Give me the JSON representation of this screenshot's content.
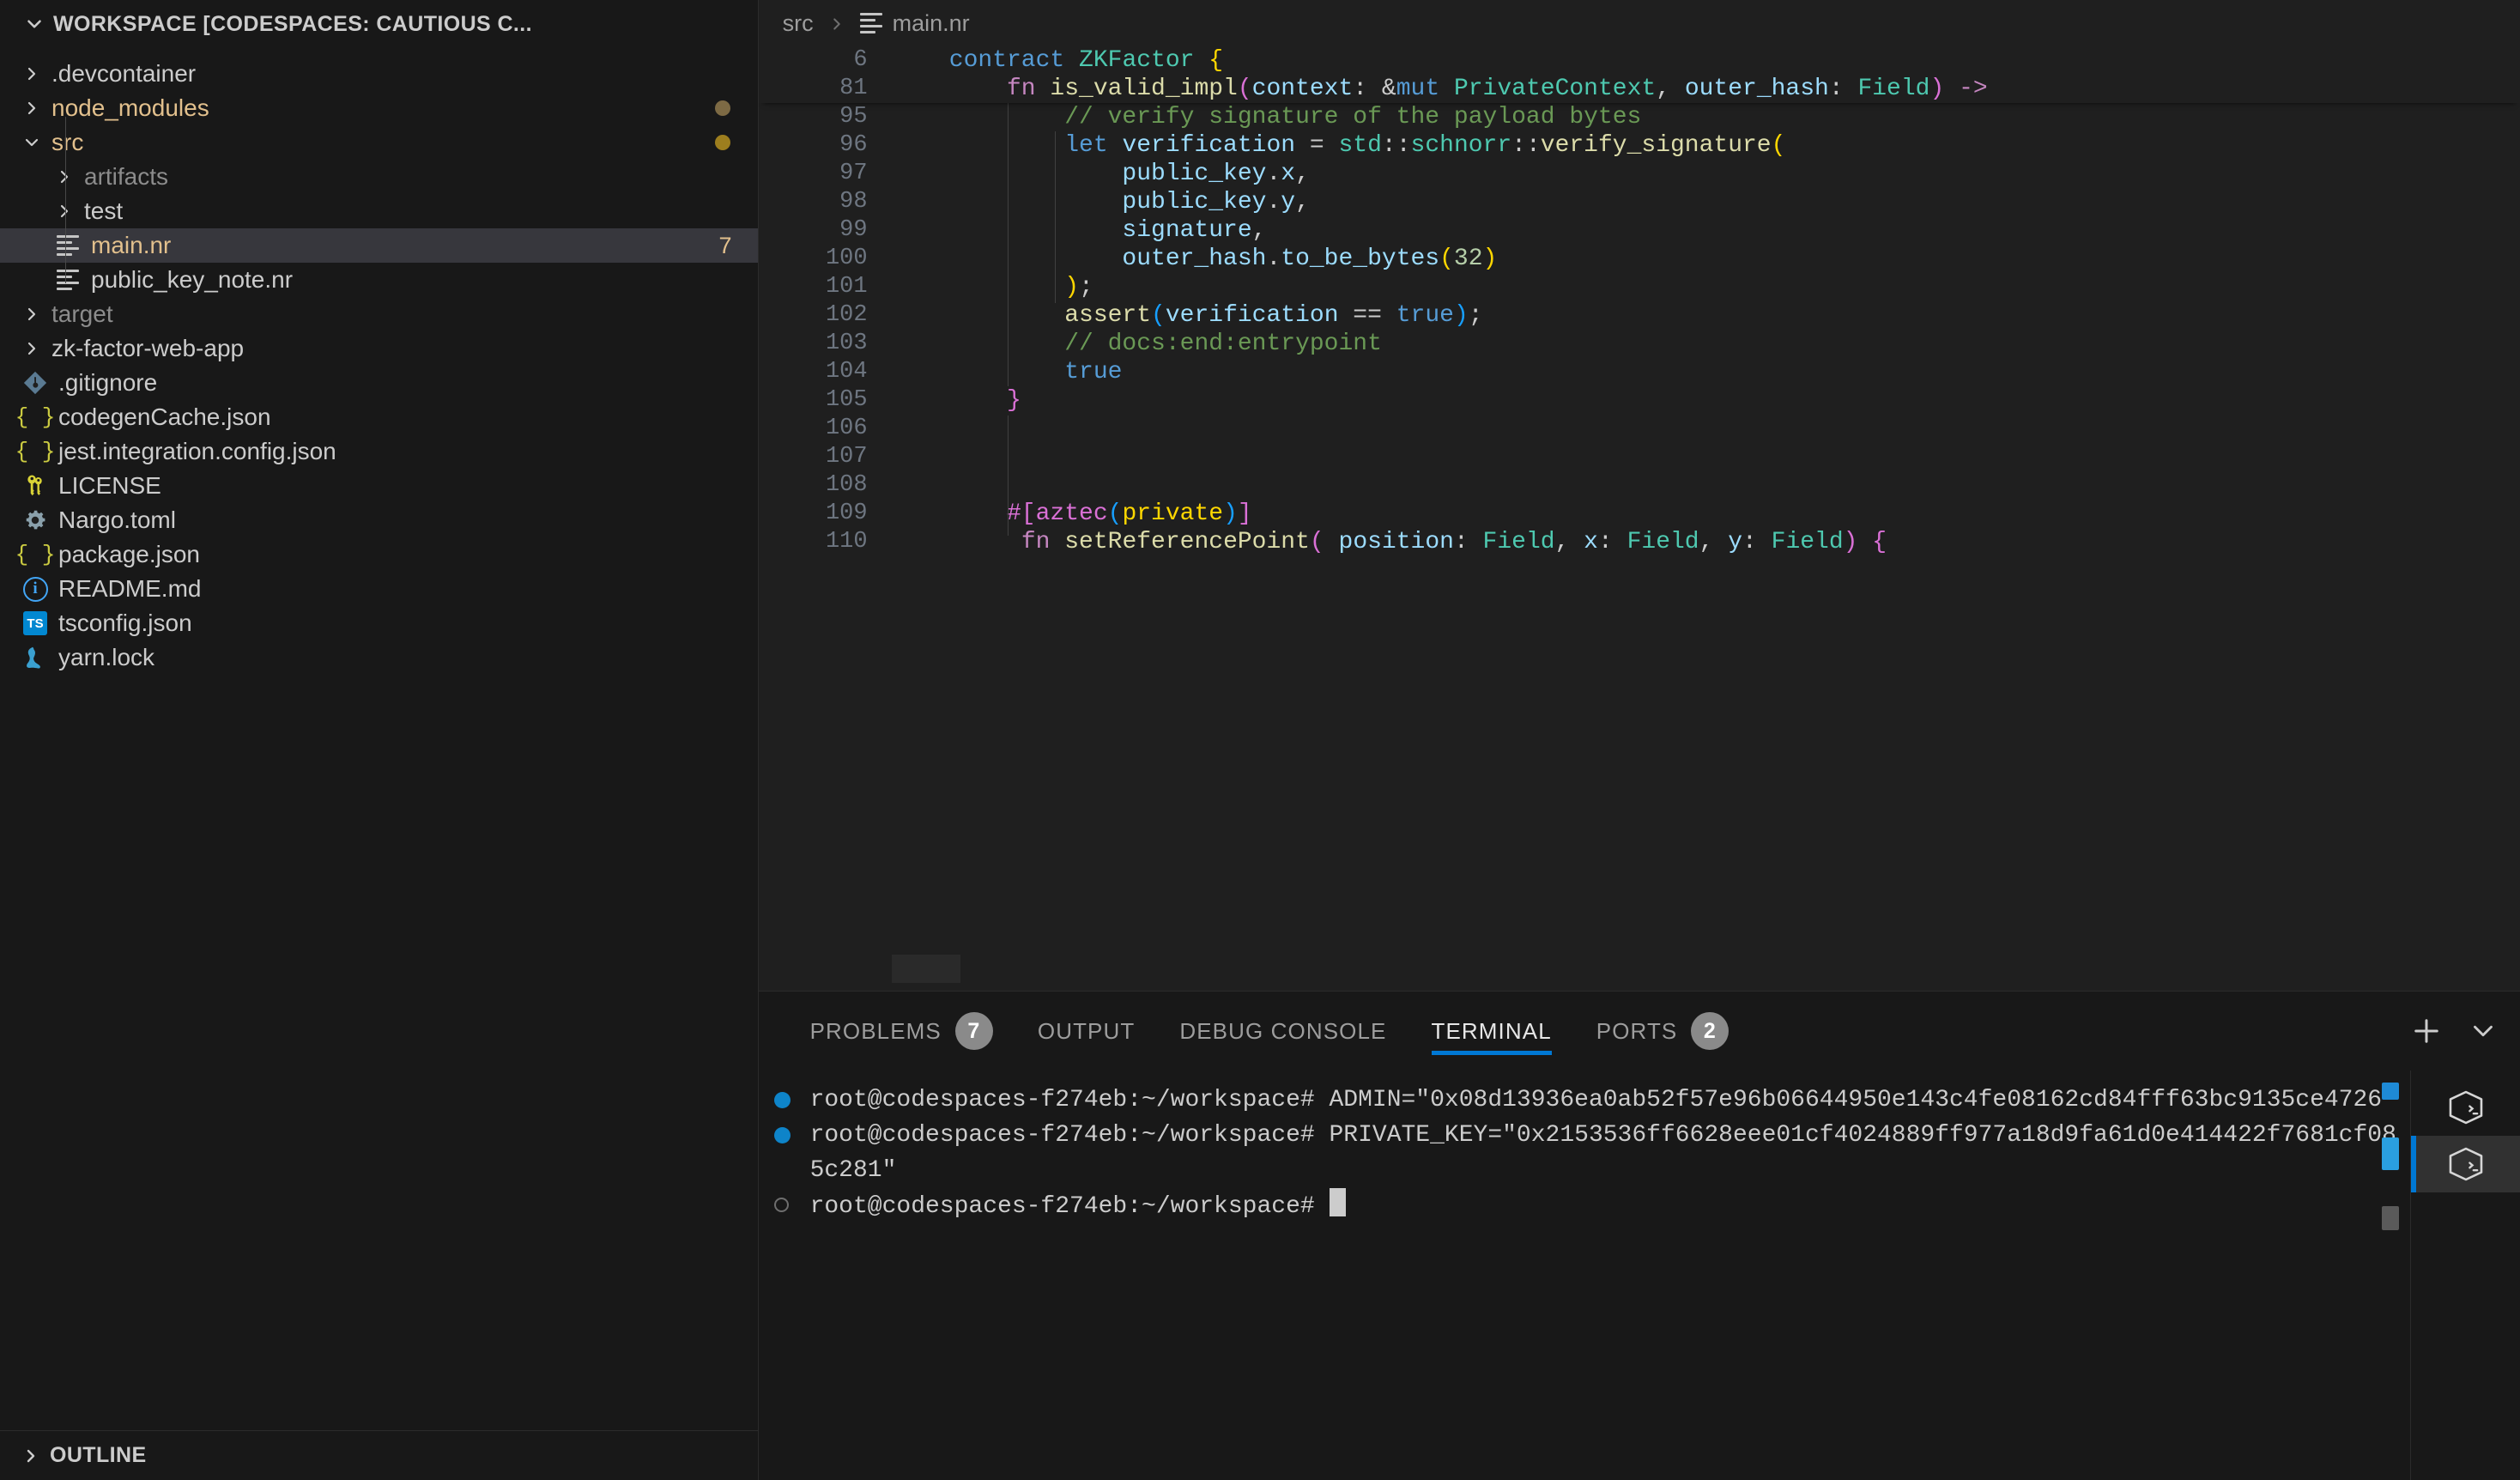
{
  "sidebar": {
    "workspace_title": "WORKSPACE [CODESPACES: CAUTIOUS C...",
    "outline_label": "OUTLINE",
    "items": [
      {
        "label": ".devcontainer",
        "kind": "folder",
        "depth": 1,
        "expanded": false,
        "color": "#cccccc",
        "icon": "chevron-right-icon",
        "badge": "",
        "dot": ""
      },
      {
        "label": "node_modules",
        "kind": "folder",
        "depth": 1,
        "expanded": false,
        "color": "#e2c08d",
        "icon": "chevron-right-icon",
        "badge": "",
        "dot": "#7d6a44"
      },
      {
        "label": "src",
        "kind": "folder",
        "depth": 1,
        "expanded": true,
        "color": "#e2c08d",
        "icon": "chevron-down-icon",
        "badge": "",
        "dot": "#9d7e1e"
      },
      {
        "label": "artifacts",
        "kind": "folder",
        "depth": 2,
        "expanded": false,
        "color": "#8c8c8c",
        "icon": "chevron-right-icon",
        "badge": "",
        "dot": ""
      },
      {
        "label": "test",
        "kind": "folder",
        "depth": 2,
        "expanded": false,
        "color": "#cccccc",
        "icon": "chevron-right-icon",
        "badge": "",
        "dot": ""
      },
      {
        "label": "main.nr",
        "kind": "file-lines",
        "depth": 2,
        "selected": true,
        "color": "#e2c08d",
        "icon": "file-lines-icon",
        "badge": "7",
        "dot": ""
      },
      {
        "label": "public_key_note.nr",
        "kind": "file-lines",
        "depth": 2,
        "color": "#cccccc",
        "icon": "file-lines-icon",
        "badge": "",
        "dot": ""
      },
      {
        "label": "target",
        "kind": "folder",
        "depth": 1,
        "expanded": false,
        "color": "#8c8c8c",
        "icon": "chevron-right-icon",
        "badge": "",
        "dot": ""
      },
      {
        "label": "zk-factor-web-app",
        "kind": "folder",
        "depth": 1,
        "expanded": false,
        "color": "#cccccc",
        "icon": "chevron-right-icon",
        "badge": "",
        "dot": ""
      },
      {
        "label": ".gitignore",
        "kind": "file-git",
        "depth": 1,
        "color": "#cccccc",
        "icon": "git-icon",
        "badge": "",
        "dot": ""
      },
      {
        "label": "codegenCache.json",
        "kind": "file-json",
        "depth": 1,
        "color": "#cccccc",
        "icon": "json-icon",
        "badge": "",
        "dot": ""
      },
      {
        "label": "jest.integration.config.json",
        "kind": "file-json",
        "depth": 1,
        "color": "#cccccc",
        "icon": "json-icon",
        "badge": "",
        "dot": ""
      },
      {
        "label": "LICENSE",
        "kind": "file-key",
        "depth": 1,
        "color": "#cccccc",
        "icon": "key-icon",
        "badge": "",
        "dot": ""
      },
      {
        "label": "Nargo.toml",
        "kind": "file-gear",
        "depth": 1,
        "color": "#cccccc",
        "icon": "gear-icon",
        "badge": "",
        "dot": ""
      },
      {
        "label": "package.json",
        "kind": "file-json",
        "depth": 1,
        "color": "#cccccc",
        "icon": "json-icon",
        "badge": "",
        "dot": ""
      },
      {
        "label": "README.md",
        "kind": "file-md",
        "depth": 1,
        "color": "#cccccc",
        "icon": "info-icon",
        "badge": "",
        "dot": ""
      },
      {
        "label": "tsconfig.json",
        "kind": "file-ts",
        "depth": 1,
        "color": "#cccccc",
        "icon": "typescript-icon",
        "badge": "",
        "dot": ""
      },
      {
        "label": "yarn.lock",
        "kind": "file-yarn",
        "depth": 1,
        "color": "#cccccc",
        "icon": "yarn-cat-icon",
        "badge": "",
        "dot": ""
      }
    ]
  },
  "breadcrumb": {
    "folder": "src",
    "separator": ">",
    "file": "main.nr"
  },
  "editor": {
    "sticky_lines": [
      {
        "num": "6",
        "tokens": [
          {
            "t": "    ",
            "c": "t-pun"
          },
          {
            "t": "contract ",
            "c": "t-kw"
          },
          {
            "t": "ZKFactor",
            "c": "t-type"
          },
          {
            "t": " ",
            "c": "t-pun"
          },
          {
            "t": "{",
            "c": "t-p1"
          }
        ]
      },
      {
        "num": "81",
        "tokens": [
          {
            "t": "        ",
            "c": "t-pun"
          },
          {
            "t": "fn ",
            "c": "t-kw2"
          },
          {
            "t": "is_valid_impl",
            "c": "t-fn"
          },
          {
            "t": "(",
            "c": "t-p2"
          },
          {
            "t": "context",
            "c": "t-var"
          },
          {
            "t": ": &",
            "c": "t-pun"
          },
          {
            "t": "mut",
            "c": "t-kw"
          },
          {
            "t": " ",
            "c": "t-pun"
          },
          {
            "t": "PrivateContext",
            "c": "t-type"
          },
          {
            "t": ", ",
            "c": "t-pun"
          },
          {
            "t": "outer_hash",
            "c": "t-var"
          },
          {
            "t": ": ",
            "c": "t-pun"
          },
          {
            "t": "Field",
            "c": "t-type"
          },
          {
            "t": ")",
            "c": "t-p2"
          },
          {
            "t": " ",
            "c": "t-pun"
          },
          {
            "t": "->",
            "c": "t-kw2"
          }
        ]
      }
    ],
    "lines": [
      {
        "num": "95",
        "partial": true,
        "tokens": [
          {
            "t": "            ",
            "c": "t-pun"
          },
          {
            "t": "// verify signature of the payload bytes",
            "c": "t-cmt"
          }
        ]
      },
      {
        "num": "96",
        "tokens": [
          {
            "t": "            ",
            "c": "t-pun"
          },
          {
            "t": "let ",
            "c": "t-kw"
          },
          {
            "t": "verification",
            "c": "t-var"
          },
          {
            "t": " = ",
            "c": "t-pun"
          },
          {
            "t": "std",
            "c": "t-type"
          },
          {
            "t": "::",
            "c": "t-pun"
          },
          {
            "t": "schnorr",
            "c": "t-type"
          },
          {
            "t": "::",
            "c": "t-pun"
          },
          {
            "t": "verify_signature",
            "c": "t-fn"
          },
          {
            "t": "(",
            "c": "t-p1"
          }
        ]
      },
      {
        "num": "97",
        "tokens": [
          {
            "t": "                ",
            "c": "t-pun"
          },
          {
            "t": "public_key",
            "c": "t-var"
          },
          {
            "t": ".",
            "c": "t-pun"
          },
          {
            "t": "x",
            "c": "t-var"
          },
          {
            "t": ",",
            "c": "t-pun"
          }
        ]
      },
      {
        "num": "98",
        "tokens": [
          {
            "t": "                ",
            "c": "t-pun"
          },
          {
            "t": "public_key",
            "c": "t-var"
          },
          {
            "t": ".",
            "c": "t-pun"
          },
          {
            "t": "y",
            "c": "t-var"
          },
          {
            "t": ",",
            "c": "t-pun"
          }
        ]
      },
      {
        "num": "99",
        "tokens": [
          {
            "t": "                ",
            "c": "t-pun"
          },
          {
            "t": "signature",
            "c": "t-var"
          },
          {
            "t": ",",
            "c": "t-pun"
          }
        ]
      },
      {
        "num": "100",
        "tokens": [
          {
            "t": "                ",
            "c": "t-pun"
          },
          {
            "t": "outer_hash",
            "c": "t-var"
          },
          {
            "t": ".",
            "c": "t-pun"
          },
          {
            "t": "to_be_bytes",
            "c": "t-var"
          },
          {
            "t": "(",
            "c": "t-p1"
          },
          {
            "t": "32",
            "c": "t-num"
          },
          {
            "t": ")",
            "c": "t-p1"
          }
        ]
      },
      {
        "num": "101",
        "tokens": [
          {
            "t": "            ",
            "c": "t-pun"
          },
          {
            "t": ")",
            "c": "t-p1"
          },
          {
            "t": ";",
            "c": "t-pun"
          }
        ]
      },
      {
        "num": "102",
        "tokens": [
          {
            "t": "            ",
            "c": "t-pun"
          },
          {
            "t": "assert",
            "c": "t-fn"
          },
          {
            "t": "(",
            "c": "t-p3"
          },
          {
            "t": "verification",
            "c": "t-var"
          },
          {
            "t": " == ",
            "c": "t-pun"
          },
          {
            "t": "true",
            "c": "t-kw"
          },
          {
            "t": ")",
            "c": "t-p3"
          },
          {
            "t": ";",
            "c": "t-pun"
          }
        ]
      },
      {
        "num": "103",
        "tokens": [
          {
            "t": "            ",
            "c": "t-pun"
          },
          {
            "t": "// docs:end:entrypoint",
            "c": "t-cmt"
          }
        ]
      },
      {
        "num": "104",
        "tokens": [
          {
            "t": "            ",
            "c": "t-pun"
          },
          {
            "t": "true",
            "c": "t-kw"
          }
        ]
      },
      {
        "num": "105",
        "tokens": [
          {
            "t": "        ",
            "c": "t-pun"
          },
          {
            "t": "}",
            "c": "t-p2"
          }
        ]
      },
      {
        "num": "106",
        "tokens": []
      },
      {
        "num": "107",
        "tokens": []
      },
      {
        "num": "108",
        "tokens": []
      },
      {
        "num": "109",
        "tokens": [
          {
            "t": "        ",
            "c": "t-pun"
          },
          {
            "t": "#[aztec",
            "c": "t-p2"
          },
          {
            "t": "(",
            "c": "t-p3"
          },
          {
            "t": "private",
            "c": "t-p1"
          },
          {
            "t": ")",
            "c": "t-p3"
          },
          {
            "t": "]",
            "c": "t-p2"
          }
        ]
      },
      {
        "num": "110",
        "tokens": [
          {
            "t": "         ",
            "c": "t-pun"
          },
          {
            "t": "fn ",
            "c": "t-kw2"
          },
          {
            "t": "setReferencePoint",
            "c": "t-fn"
          },
          {
            "t": "(",
            "c": "t-p2"
          },
          {
            "t": " ",
            "c": "t-pun"
          },
          {
            "t": "position",
            "c": "t-var"
          },
          {
            "t": ": ",
            "c": "t-pun"
          },
          {
            "t": "Field",
            "c": "t-type"
          },
          {
            "t": ", ",
            "c": "t-pun"
          },
          {
            "t": "x",
            "c": "t-var"
          },
          {
            "t": ": ",
            "c": "t-pun"
          },
          {
            "t": "Field",
            "c": "t-type"
          },
          {
            "t": ", ",
            "c": "t-pun"
          },
          {
            "t": "y",
            "c": "t-var"
          },
          {
            "t": ": ",
            "c": "t-pun"
          },
          {
            "t": "Field",
            "c": "t-type"
          },
          {
            "t": ")",
            "c": "t-p2"
          },
          {
            "t": " ",
            "c": "t-pun"
          },
          {
            "t": "{",
            "c": "t-p2"
          }
        ]
      }
    ]
  },
  "panel": {
    "tabs": [
      {
        "label": "PROBLEMS",
        "badge": "7",
        "active": false
      },
      {
        "label": "OUTPUT",
        "badge": "",
        "active": false
      },
      {
        "label": "DEBUG CONSOLE",
        "badge": "",
        "active": false
      },
      {
        "label": "TERMINAL",
        "badge": "",
        "active": true
      },
      {
        "label": "PORTS",
        "badge": "2",
        "active": false
      }
    ],
    "add_label": "+",
    "chevron_label": "chevron-down"
  },
  "terminal": {
    "prompt": "root@codespaces-f274eb:~/workspace#",
    "lines": [
      {
        "prompt": "root@codespaces-f274eb:~/workspace#",
        "command": " ADMIN=\"0x08d13936ea0ab52f57e96b06644950e143c4fe08162cd84fff63bc9135ce4726\"",
        "state": "success"
      },
      {
        "prompt": "root@codespaces-f274eb:~/workspace#",
        "command": " PRIVATE_KEY=\"0x2153536ff6628eee01cf4024889ff977a18d9fa61d0e414422f7681cf085c281\"",
        "state": "success"
      },
      {
        "prompt": "root@codespaces-f274eb:~/workspace#",
        "command": " ",
        "state": "current"
      }
    ],
    "tabs": [
      {
        "icon": "terminal-shell-icon",
        "active": false
      },
      {
        "icon": "terminal-shell-icon",
        "active": true
      }
    ]
  },
  "colors": {
    "accent": "#0078d4",
    "editor_bg": "#1f1f1f",
    "sidebar_bg": "#181818",
    "selected_row": "#37373d",
    "modified_badge": "#e2c08d",
    "comment": "#6a9955"
  }
}
